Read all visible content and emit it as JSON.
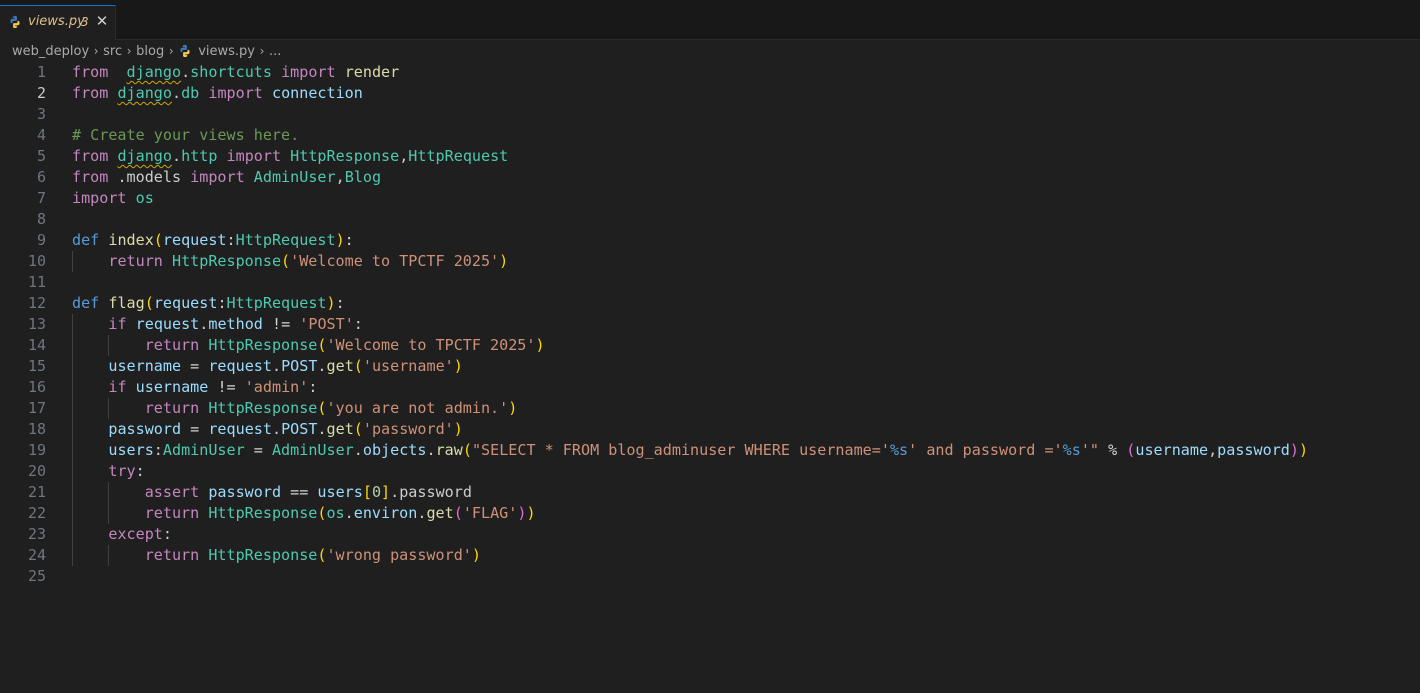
{
  "tabs": [
    {
      "filename": "views.py",
      "problems": "3",
      "active": true,
      "close_glyph": "✕",
      "icon": "python-icon"
    }
  ],
  "breadcrumb": {
    "segments": [
      "web_deploy",
      "src",
      "blog",
      "views.py",
      "..."
    ],
    "file_icon": "python-icon",
    "separator_icon": "chevron-right-icon"
  },
  "editor": {
    "active_line": 2,
    "line_numbers": [
      "1",
      "2",
      "3",
      "4",
      "5",
      "6",
      "7",
      "8",
      "9",
      "10",
      "11",
      "12",
      "13",
      "14",
      "15",
      "16",
      "17",
      "18",
      "19",
      "20",
      "21",
      "22",
      "23",
      "24",
      "25"
    ],
    "lines": [
      [
        [
          "kw",
          "from"
        ],
        [
          "",
          "  "
        ],
        [
          "cls",
          "django"
        ],
        [
          "",
          "."
        ],
        [
          "cls",
          "shortcuts"
        ],
        [
          "",
          " "
        ],
        [
          "kw",
          "import"
        ],
        [
          "",
          " "
        ],
        [
          "fn",
          "render"
        ]
      ],
      [
        [
          "kw",
          "from"
        ],
        [
          "",
          " "
        ],
        [
          "cls",
          "django"
        ],
        [
          "",
          "."
        ],
        [
          "cls",
          "db"
        ],
        [
          "",
          " "
        ],
        [
          "kw",
          "import"
        ],
        [
          "",
          " "
        ],
        [
          "var",
          "connection"
        ]
      ],
      [],
      [
        [
          "cmt",
          "# Create your views here."
        ]
      ],
      [
        [
          "kw",
          "from"
        ],
        [
          "",
          " "
        ],
        [
          "cls",
          "django"
        ],
        [
          "",
          "."
        ],
        [
          "cls",
          "http"
        ],
        [
          "",
          " "
        ],
        [
          "kw",
          "import"
        ],
        [
          "",
          " "
        ],
        [
          "cls",
          "HttpResponse"
        ],
        [
          "",
          ","
        ],
        [
          "cls",
          "HttpRequest"
        ]
      ],
      [
        [
          "kw",
          "from"
        ],
        [
          "",
          " "
        ],
        [
          "",
          "."
        ],
        [
          "",
          "models"
        ],
        [
          "",
          " "
        ],
        [
          "kw",
          "import"
        ],
        [
          "",
          " "
        ],
        [
          "cls",
          "AdminUser"
        ],
        [
          "",
          ","
        ],
        [
          "cls",
          "Blog"
        ]
      ],
      [
        [
          "kw",
          "import"
        ],
        [
          "",
          " "
        ],
        [
          "cls",
          "os"
        ]
      ],
      [],
      [
        [
          "def",
          "def"
        ],
        [
          "",
          " "
        ],
        [
          "fn",
          "index"
        ],
        [
          "p1",
          "("
        ],
        [
          "var",
          "request"
        ],
        [
          "",
          ":"
        ],
        [
          "cls",
          "HttpRequest"
        ],
        [
          "p1",
          ")"
        ],
        [
          "",
          ":"
        ]
      ],
      [
        [
          "",
          "    "
        ],
        [
          "kw",
          "return"
        ],
        [
          "",
          " "
        ],
        [
          "cls",
          "HttpResponse"
        ],
        [
          "p1",
          "("
        ],
        [
          "str",
          "'Welcome to TPCTF 2025'"
        ],
        [
          "p1",
          ")"
        ]
      ],
      [],
      [
        [
          "def",
          "def"
        ],
        [
          "",
          " "
        ],
        [
          "fn",
          "flag"
        ],
        [
          "p1",
          "("
        ],
        [
          "var",
          "request"
        ],
        [
          "",
          ":"
        ],
        [
          "cls",
          "HttpRequest"
        ],
        [
          "p1",
          ")"
        ],
        [
          "",
          ":"
        ]
      ],
      [
        [
          "",
          "    "
        ],
        [
          "kw",
          "if"
        ],
        [
          "",
          " "
        ],
        [
          "var",
          "request"
        ],
        [
          "",
          "."
        ],
        [
          "var",
          "method"
        ],
        [
          "",
          " "
        ],
        [
          "op",
          "!="
        ],
        [
          "",
          " "
        ],
        [
          "str",
          "'POST'"
        ],
        [
          "",
          ":"
        ]
      ],
      [
        [
          "",
          "        "
        ],
        [
          "kw",
          "return"
        ],
        [
          "",
          " "
        ],
        [
          "cls",
          "HttpResponse"
        ],
        [
          "p1",
          "("
        ],
        [
          "str",
          "'Welcome to TPCTF 2025'"
        ],
        [
          "p1",
          ")"
        ]
      ],
      [
        [
          "",
          "    "
        ],
        [
          "var",
          "username"
        ],
        [
          "",
          " "
        ],
        [
          "op",
          "="
        ],
        [
          "",
          " "
        ],
        [
          "var",
          "request"
        ],
        [
          "",
          "."
        ],
        [
          "var",
          "POST"
        ],
        [
          "",
          "."
        ],
        [
          "fn",
          "get"
        ],
        [
          "p1",
          "("
        ],
        [
          "str",
          "'username'"
        ],
        [
          "p1",
          ")"
        ]
      ],
      [
        [
          "",
          "    "
        ],
        [
          "kw",
          "if"
        ],
        [
          "",
          " "
        ],
        [
          "var",
          "username"
        ],
        [
          "",
          " "
        ],
        [
          "op",
          "!="
        ],
        [
          "",
          " "
        ],
        [
          "str",
          "'admin'"
        ],
        [
          "",
          ":"
        ]
      ],
      [
        [
          "",
          "        "
        ],
        [
          "kw",
          "return"
        ],
        [
          "",
          " "
        ],
        [
          "cls",
          "HttpResponse"
        ],
        [
          "p1",
          "("
        ],
        [
          "str",
          "'you are not admin.'"
        ],
        [
          "p1",
          ")"
        ]
      ],
      [
        [
          "",
          "    "
        ],
        [
          "var",
          "password"
        ],
        [
          "",
          " "
        ],
        [
          "op",
          "="
        ],
        [
          "",
          " "
        ],
        [
          "var",
          "request"
        ],
        [
          "",
          "."
        ],
        [
          "var",
          "POST"
        ],
        [
          "",
          "."
        ],
        [
          "fn",
          "get"
        ],
        [
          "p1",
          "("
        ],
        [
          "str",
          "'password'"
        ],
        [
          "p1",
          ")"
        ]
      ],
      [
        [
          "",
          "    "
        ],
        [
          "var",
          "users"
        ],
        [
          "",
          ":"
        ],
        [
          "cls",
          "AdminUser"
        ],
        [
          "",
          " "
        ],
        [
          "op",
          "="
        ],
        [
          "",
          " "
        ],
        [
          "cls",
          "AdminUser"
        ],
        [
          "",
          "."
        ],
        [
          "var",
          "objects"
        ],
        [
          "",
          "."
        ],
        [
          "fn",
          "raw"
        ],
        [
          "p1",
          "("
        ],
        [
          "str",
          "\"SELECT * FROM blog_adminuser WHERE username='"
        ],
        [
          "fmt",
          "%s"
        ],
        [
          "str",
          "' and password ='"
        ],
        [
          "fmt",
          "%s"
        ],
        [
          "str",
          "'\""
        ],
        [
          "",
          " "
        ],
        [
          "op",
          "%"
        ],
        [
          "",
          " "
        ],
        [
          "p2",
          "("
        ],
        [
          "var",
          "username"
        ],
        [
          "",
          ","
        ],
        [
          "var",
          "password"
        ],
        [
          "p2",
          ")"
        ],
        [
          "p1",
          ")"
        ]
      ],
      [
        [
          "",
          "    "
        ],
        [
          "kw",
          "try"
        ],
        [
          "",
          ":"
        ]
      ],
      [
        [
          "",
          "        "
        ],
        [
          "kw",
          "assert"
        ],
        [
          "",
          " "
        ],
        [
          "var",
          "password"
        ],
        [
          "",
          " "
        ],
        [
          "op",
          "=="
        ],
        [
          "",
          " "
        ],
        [
          "var",
          "users"
        ],
        [
          "p1",
          "["
        ],
        [
          "num",
          "0"
        ],
        [
          "p1",
          "]"
        ],
        [
          "",
          "."
        ],
        [
          "",
          "password"
        ]
      ],
      [
        [
          "",
          "        "
        ],
        [
          "kw",
          "return"
        ],
        [
          "",
          " "
        ],
        [
          "cls",
          "HttpResponse"
        ],
        [
          "p1",
          "("
        ],
        [
          "cls",
          "os"
        ],
        [
          "",
          "."
        ],
        [
          "var",
          "environ"
        ],
        [
          "",
          "."
        ],
        [
          "fn",
          "get"
        ],
        [
          "p2",
          "("
        ],
        [
          "str",
          "'FLAG'"
        ],
        [
          "p2",
          ")"
        ],
        [
          "p1",
          ")"
        ]
      ],
      [
        [
          "",
          "    "
        ],
        [
          "kw",
          "except"
        ],
        [
          "",
          ":"
        ]
      ],
      [
        [
          "",
          "        "
        ],
        [
          "kw",
          "return"
        ],
        [
          "",
          " "
        ],
        [
          "cls",
          "HttpResponse"
        ],
        [
          "p1",
          "("
        ],
        [
          "str",
          "'wrong password'"
        ],
        [
          "p1",
          ")"
        ]
      ],
      []
    ],
    "squiggles": [
      {
        "line": 1,
        "token": 2
      },
      {
        "line": 2,
        "token": 2
      },
      {
        "line": 5,
        "token": 2
      }
    ]
  },
  "colors": {
    "background": "#1f1f1f",
    "tab_text": "#e2c08d",
    "keyword": "#c586c0",
    "def": "#569cd6",
    "function": "#dcdcaa",
    "class": "#4ec9b0",
    "variable": "#9cdcfe",
    "string": "#ce9178",
    "comment": "#6a9955",
    "bracket_1": "#ffd700",
    "bracket_2": "#da70d6"
  }
}
